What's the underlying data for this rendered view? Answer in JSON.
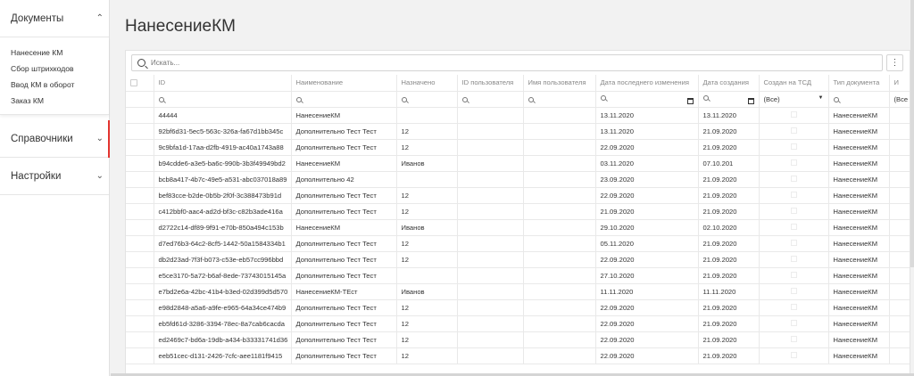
{
  "sidebar": {
    "documents_label": "Документы",
    "document_items": [
      "Нанесение КМ",
      "Сбор штрихкодов",
      "Ввод КМ в оборот",
      "Заказ КМ"
    ],
    "reference_label": "Справочники",
    "settings_label": "Настройки"
  },
  "page": {
    "title": "НанесениеКМ"
  },
  "search": {
    "placeholder": "Искать..."
  },
  "table": {
    "columns": [
      "ID",
      "Наименование",
      "Назначено",
      "ID пользователя",
      "Имя пользователя",
      "Дата последнего изменения",
      "Дата создания",
      "Создан на ТСД",
      "Тип документа",
      "И"
    ],
    "filter_select_value": "(Все)",
    "filter_select_value_2": "(Все",
    "rows": [
      [
        "44444",
        "НанесениеКМ",
        "",
        "",
        "",
        "13.11.2020",
        "13.11.2020",
        "",
        "НанесениеКМ"
      ],
      [
        "92bf6d31-5ec5-563c-326a-fa67d1bb345c",
        "Дополнительно Тест Тест",
        "12",
        "",
        "",
        "13.11.2020",
        "21.09.2020",
        "",
        "НанесениеКМ"
      ],
      [
        "9c9bfa1d-17aa-d2fb-4919-ac40a1743a88",
        "Дополнительно Тест Тест",
        "12",
        "",
        "",
        "22.09.2020",
        "21.09.2020",
        "",
        "НанесениеКМ"
      ],
      [
        "b94cdde6-a3e5-ba6c-990b-3b3f49949bd2",
        "НанесениеКМ",
        "Иванов",
        "",
        "",
        "03.11.2020",
        "07.10.201",
        "",
        "НанесениеКМ"
      ],
      [
        "bcb8a417-4b7c-49e5-a531-abc037018a89",
        "Дополнительно 42",
        "",
        "",
        "",
        "23.09.2020",
        "21.09.2020",
        "",
        "НанесениеКМ"
      ],
      [
        "bef83cce-b2de-0b5b-2f0f-3c388473b91d",
        "Дополнительно Тест Тест",
        "12",
        "",
        "",
        "22.09.2020",
        "21.09.2020",
        "",
        "НанесениеКМ"
      ],
      [
        "c412bbf0-aac4-ad2d-bf3c-c82b3ade416a",
        "Дополнительно Тест Тест",
        "12",
        "",
        "",
        "21.09.2020",
        "21.09.2020",
        "",
        "НанесениеКМ"
      ],
      [
        "d2722c14-df89-9f91-e70b-850a494c153b",
        "НанесениеКМ",
        "Иванов",
        "",
        "",
        "29.10.2020",
        "02.10.2020",
        "",
        "НанесениеКМ"
      ],
      [
        "d7ed76b3-64c2-8cf5-1442-50a1584334b1",
        "Дополнительно Тест Тест",
        "12",
        "",
        "",
        "05.11.2020",
        "21.09.2020",
        "",
        "НанесениеКМ"
      ],
      [
        "db2d23ad-7f3f-b073-c53e-eb57cc996bbd",
        "Дополнительно Тест Тест",
        "12",
        "",
        "",
        "22.09.2020",
        "21.09.2020",
        "",
        "НанесениеКМ"
      ],
      [
        "e5ce3170-5a72-b6af-8ede-73743015145a",
        "Дополнительно Тест Тест",
        "",
        "",
        "",
        "27.10.2020",
        "21.09.2020",
        "",
        "НанесениеКМ"
      ],
      [
        "e7bd2e6a-42bc-41b4-b3ed-02d399d5d570",
        "НанесениеКМ-ТЕст",
        "Иванов",
        "",
        "",
        "11.11.2020",
        "11.11.2020",
        "",
        "НанесениеКМ"
      ],
      [
        "e98d2848-a5a6-a9fe-e965-64a34ce474b9",
        "Дополнительно Тест Тест",
        "12",
        "",
        "",
        "22.09.2020",
        "21.09.2020",
        "",
        "НанесениеКМ"
      ],
      [
        "eb5fd61d-3286-3394-78ec-8a7cab6cacda",
        "Дополнительно Тест Тест",
        "12",
        "",
        "",
        "22.09.2020",
        "21.09.2020",
        "",
        "НанесениеКМ"
      ],
      [
        "ed2469c7-bd6a-19db-a434-b33331741d36",
        "Дополнительно Тест Тест",
        "12",
        "",
        "",
        "22.09.2020",
        "21.09.2020",
        "",
        "НанесениеКМ"
      ],
      [
        "eeb51cec-d131-2426-7cfc-aee1181f9415",
        "Дополнительно Тест Тест",
        "12",
        "",
        "",
        "22.09.2020",
        "21.09.2020",
        "",
        "НанесениеКМ"
      ]
    ]
  }
}
